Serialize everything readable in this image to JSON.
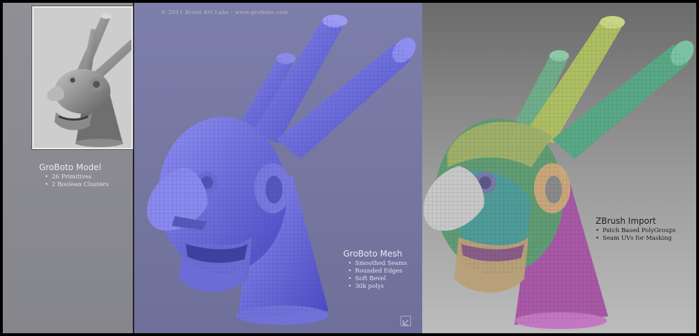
{
  "copyright": "© 2011 Braid Art Labs · www.groboto.com",
  "left_panel": {
    "title": "GroBoto Model",
    "bullets": [
      "26 Primitives",
      "2 Boolean Clusters"
    ]
  },
  "middle_panel": {
    "title": "GroBoto Mesh",
    "bullets": [
      "Smoothed Seams",
      "Rounded Edges",
      "Soft Bevel",
      "30k polys"
    ]
  },
  "right_panel": {
    "title": "ZBrush Import",
    "bullets": [
      "Patch Based PolyGroups",
      "Seam UVs for Masking"
    ]
  },
  "colors": {
    "mesh_blue": "#6e6ee0",
    "thumb_gray": "#9a9a9a",
    "polygroup_green": "#6fb08a",
    "polygroup_yellow": "#b9c46a",
    "polygroup_purple": "#b35fae",
    "polygroup_teal": "#58a6a4",
    "polygroup_tan": "#c9a77a"
  }
}
